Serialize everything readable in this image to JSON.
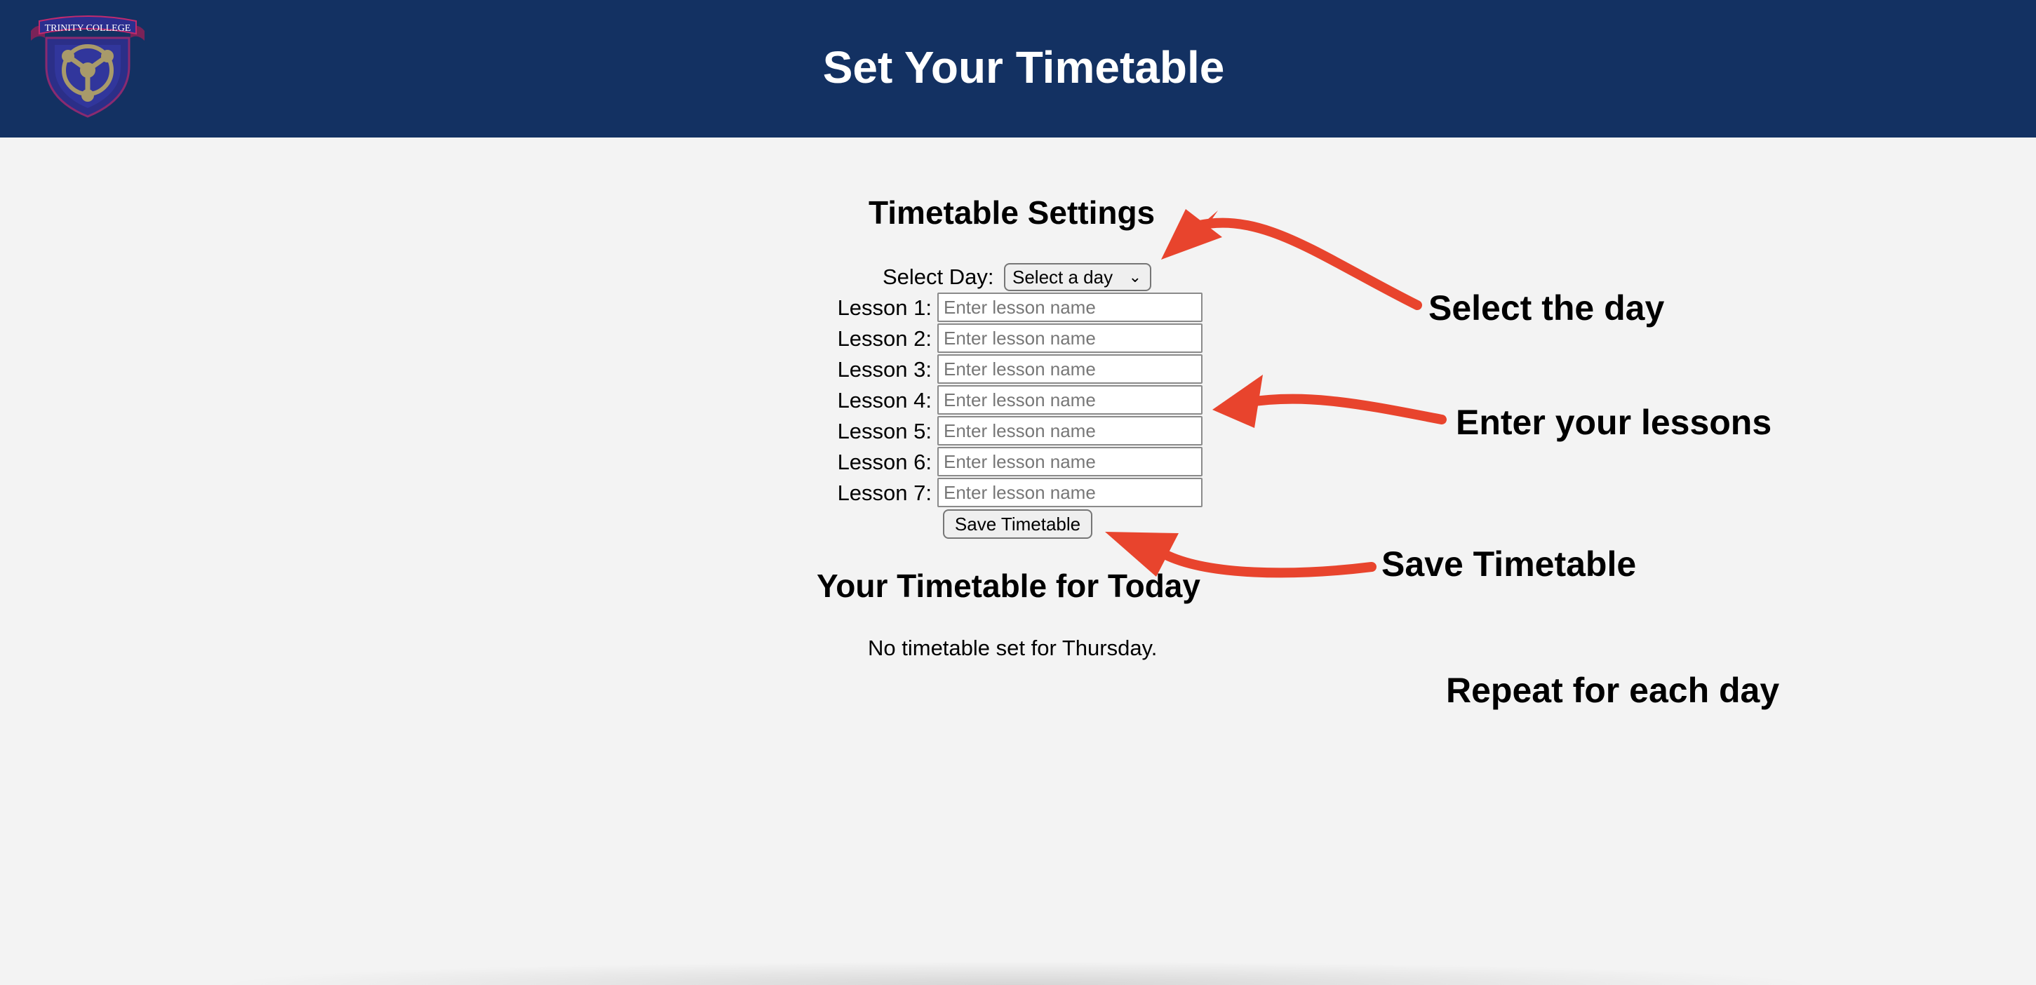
{
  "header": {
    "title": "Set Your Timetable",
    "logo_text": "TRINITY COLLEGE"
  },
  "settings": {
    "heading": "Timetable Settings",
    "select_day_label": "Select Day:",
    "select_day_value": "Select a day",
    "lessons": [
      {
        "label": "Lesson 1:",
        "placeholder": "Enter lesson name"
      },
      {
        "label": "Lesson 2:",
        "placeholder": "Enter lesson name"
      },
      {
        "label": "Lesson 3:",
        "placeholder": "Enter lesson name"
      },
      {
        "label": "Lesson 4:",
        "placeholder": "Enter lesson name"
      },
      {
        "label": "Lesson 5:",
        "placeholder": "Enter lesson name"
      },
      {
        "label": "Lesson 6:",
        "placeholder": "Enter lesson name"
      },
      {
        "label": "Lesson 7:",
        "placeholder": "Enter lesson name"
      }
    ],
    "save_button": "Save Timetable"
  },
  "today": {
    "heading": "Your Timetable for Today",
    "status": "No timetable set for Thursday."
  },
  "annotations": {
    "select_day": "Select the day",
    "enter_lessons": "Enter your lessons",
    "save_timetable": "Save Timetable",
    "repeat": "Repeat for each day"
  },
  "colors": {
    "header_bg": "#133162",
    "page_bg": "#f3f3f3",
    "arrow": "#e8442d"
  }
}
